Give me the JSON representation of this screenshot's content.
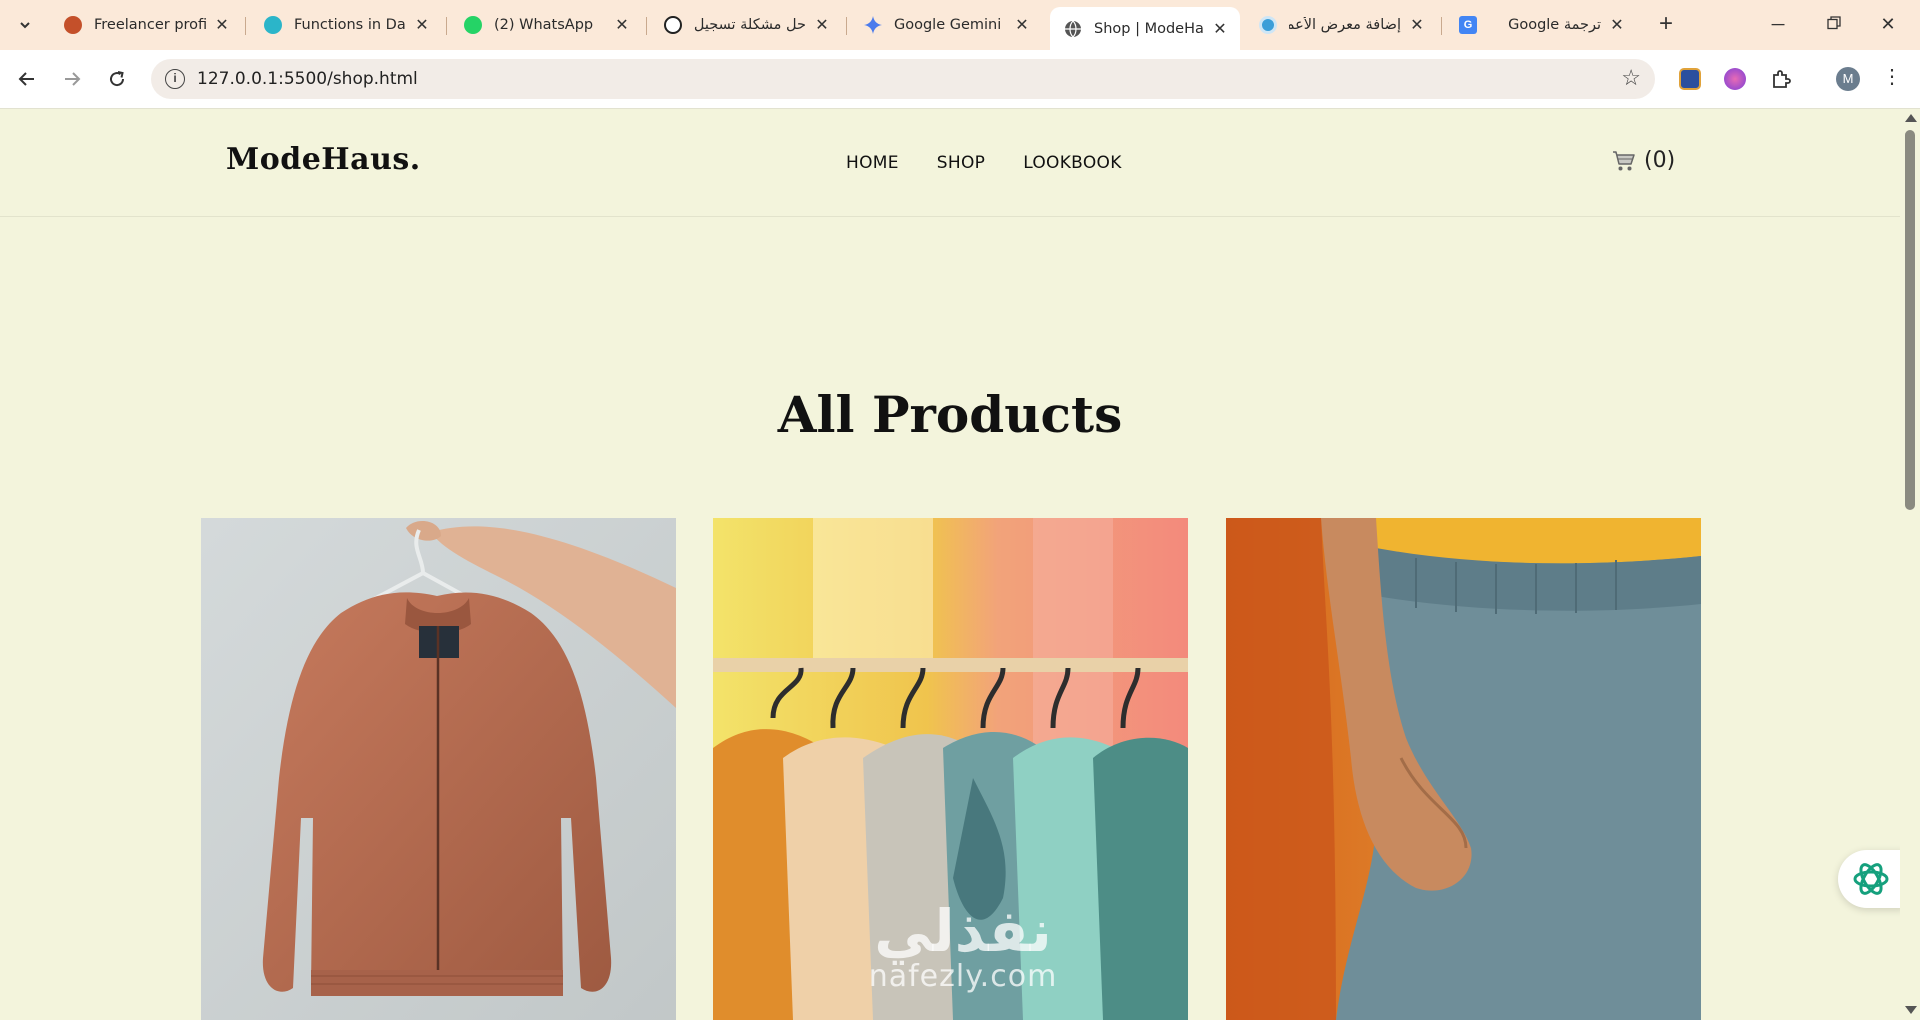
{
  "browser": {
    "tabs": [
      {
        "title": "Freelancer profile",
        "favicon": "freelancer-icon",
        "color": "#c4502a"
      },
      {
        "title": "Functions in Dart",
        "favicon": "dart-doc-icon",
        "color": "#2bb5c9"
      },
      {
        "title": "(2) WhatsApp",
        "favicon": "whatsapp-icon",
        "color": "#25d366"
      },
      {
        "title": "حل مشكلة تسجيل",
        "favicon": "chatgpt-icon",
        "color": "#222222"
      },
      {
        "title": "Google Gemini",
        "favicon": "gemini-icon",
        "color": "#4b7bec"
      },
      {
        "title": "Shop | ModeHaus",
        "favicon": "globe-icon",
        "color": "#444444",
        "active": true
      },
      {
        "title": "إضافة معرض الأعمال",
        "favicon": "site-icon",
        "color": "#3b9ed8"
      },
      {
        "title": "ترجمة Google",
        "favicon": "google-translate-icon",
        "color": "#4285f4"
      }
    ],
    "url": "127.0.0.1:5500/shop.html",
    "profile_initial": "M"
  },
  "site": {
    "logo": "ModeHaus.",
    "nav": [
      "HOME",
      "SHOP",
      "LOOKBOOK"
    ],
    "cart_count": "(0)"
  },
  "main": {
    "heading": "All Products"
  },
  "products": [
    {
      "image": "brown-bomber-jacket-on-hanger"
    },
    {
      "image": "colorful-jackets-on-rack"
    },
    {
      "image": "blue-pants-hand-in-pocket"
    }
  ],
  "watermark": {
    "arabic": "نفذلي",
    "latin": "nafezly.com"
  }
}
